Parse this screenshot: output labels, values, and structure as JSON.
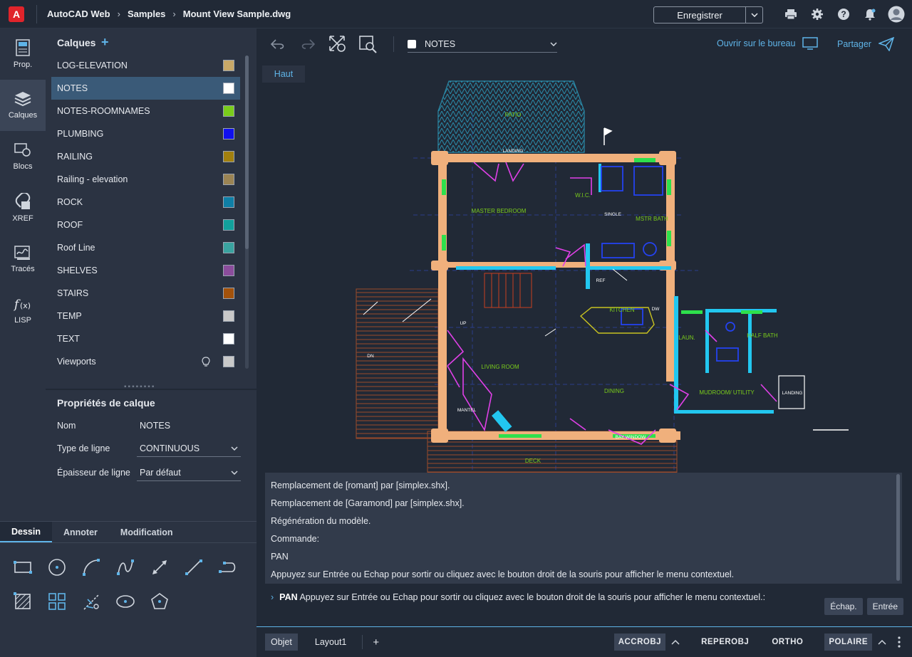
{
  "app": {
    "logo_letter": "A",
    "breadcrumbs": [
      "AutoCAD Web",
      "Samples",
      "Mount View Sample.dwg"
    ]
  },
  "header": {
    "save_label": "Enregistrer",
    "icons": [
      "printer-icon",
      "gear-icon",
      "help-icon",
      "bell-icon",
      "avatar"
    ]
  },
  "rail": [
    {
      "label": "Prop.",
      "icon": "properties-icon"
    },
    {
      "label": "Calques",
      "icon": "layers-icon",
      "active": true
    },
    {
      "label": "Blocs",
      "icon": "blocks-icon"
    },
    {
      "label": "XREF",
      "icon": "xref-icon"
    },
    {
      "label": "Tracés",
      "icon": "traces-icon"
    },
    {
      "label": "LISP",
      "icon": "lisp-icon"
    }
  ],
  "layers_panel": {
    "title": "Calques",
    "layers": [
      {
        "name": "LOG-ELEVATION",
        "color": "#c9a968"
      },
      {
        "name": "NOTES",
        "color": "#ffffff",
        "selected": true
      },
      {
        "name": "NOTES-ROOMNAMES",
        "color": "#7acc1b"
      },
      {
        "name": "PLUMBING",
        "color": "#1010ee"
      },
      {
        "name": "RAILING",
        "color": "#a2800f"
      },
      {
        "name": "Railing - elevation",
        "color": "#9b8454"
      },
      {
        "name": "ROCK",
        "color": "#0f7fa6"
      },
      {
        "name": "ROOF",
        "color": "#12a19c"
      },
      {
        "name": "Roof Line",
        "color": "#3aa3a0"
      },
      {
        "name": "SHELVES",
        "color": "#8b4d9c"
      },
      {
        "name": "STAIRS",
        "color": "#a3520b"
      },
      {
        "name": "TEMP",
        "color": "#c9c9c9"
      },
      {
        "name": "TEXT",
        "color": "#ffffff"
      },
      {
        "name": "Viewports",
        "color": "#c9c9c9"
      }
    ]
  },
  "layer_props": {
    "title": "Propriétés de calque",
    "name_label": "Nom",
    "name_value": "NOTES",
    "linetype_label": "Type de ligne",
    "linetype_value": "CONTINUOUS",
    "lineweight_label": "Épaisseur de ligne",
    "lineweight_value": "Par défaut"
  },
  "tools": {
    "tabs": [
      "Dessin",
      "Annoter",
      "Modification"
    ]
  },
  "toolbar": {
    "current_layer": "NOTES",
    "open_desktop": "Ouvrir sur le bureau",
    "share": "Partager"
  },
  "canvas": {
    "view_label": "Haut",
    "room_labels": [
      "PATIO",
      "LANDING",
      "W.I.C.",
      "MASTER BEDROOM",
      "MSTR BATH",
      "SINGLE",
      "KITCHEN",
      "LAUN.",
      "HALF BATH",
      "LIVING ROOM",
      "DINING",
      "MUDROOM/ UTILITY",
      "DECK",
      "MANTEL",
      "BAY WINDOW",
      "REF",
      "DW",
      "DN",
      "UP",
      "LANDING"
    ]
  },
  "command_log": [
    "Remplacement de [romant] par [simplex.shx].",
    "Remplacement de [Garamond] par [simplex.shx].",
    "Régénération du modèle.",
    "Commande:",
    "PAN",
    "Appuyez sur Entrée ou Echap pour sortir ou cliquez avec le bouton droit de la souris pour afficher le menu contextuel."
  ],
  "command_prompt": {
    "keyword": "PAN",
    "text": "Appuyez sur Entrée ou Echap pour sortir ou cliquez avec le bouton droit de la souris pour afficher le menu contextuel.:",
    "esc": "Échap.",
    "enter": "Entrée"
  },
  "statusbar": {
    "tabs": [
      "Objet",
      "Layout1"
    ],
    "add": "+",
    "toggles": [
      "ACCROBJ",
      "REPEROBJ",
      "ORTHO",
      "POLAIRE"
    ]
  }
}
